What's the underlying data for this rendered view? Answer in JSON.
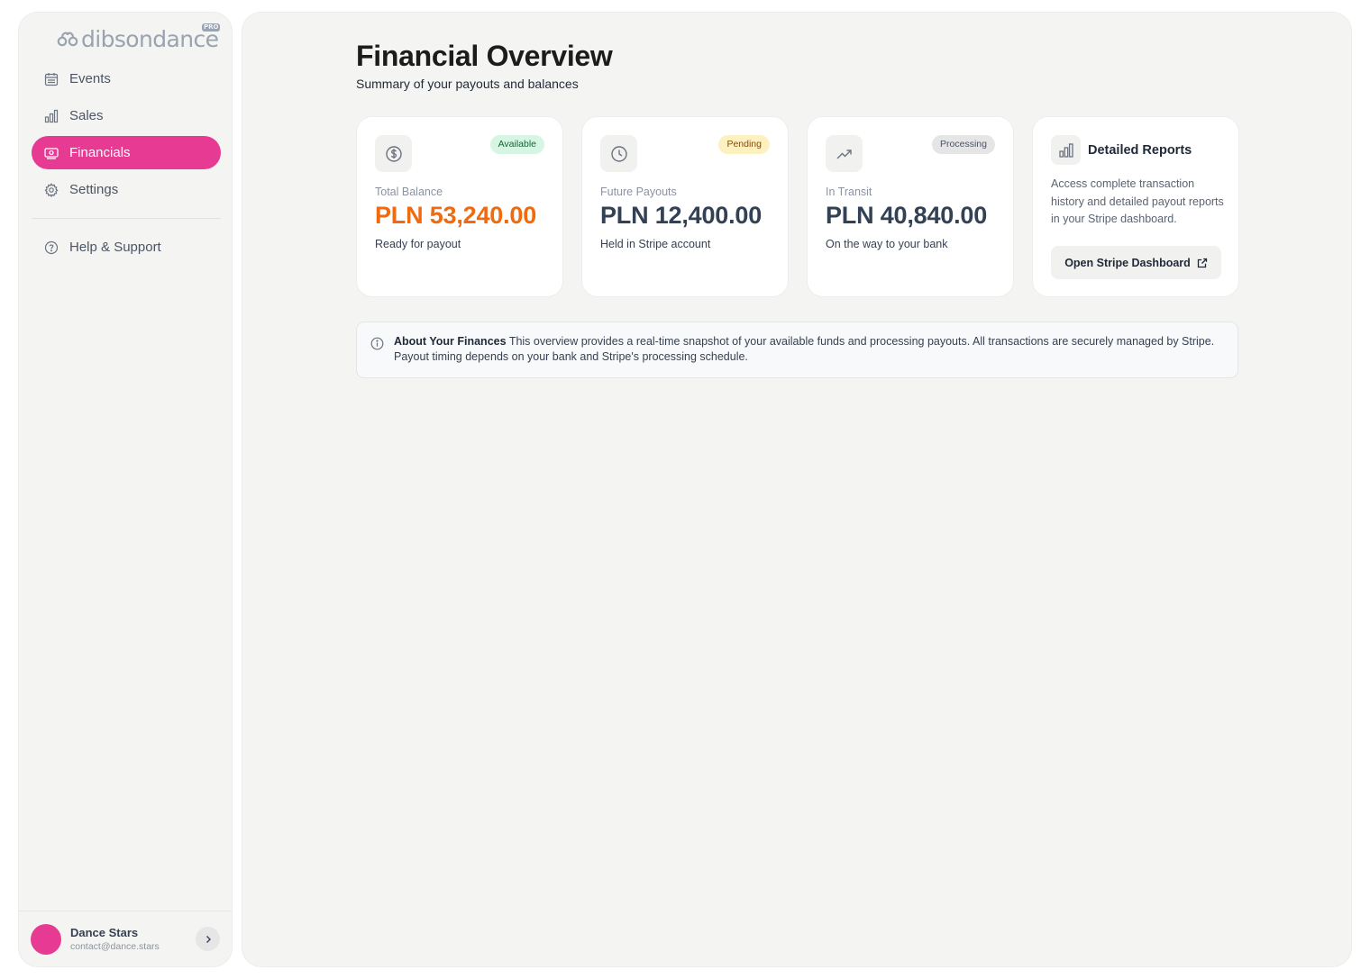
{
  "brand": {
    "logo_text": "dibsondance",
    "logo_badge": "PRO",
    "accent_color": "#e63a93"
  },
  "sidebar": {
    "items": [
      {
        "label": "Events",
        "icon": "calendar-icon",
        "active": false
      },
      {
        "label": "Sales",
        "icon": "bar-chart-icon",
        "active": false
      },
      {
        "label": "Financials",
        "icon": "money-icon",
        "active": true
      },
      {
        "label": "Settings",
        "icon": "gear-icon",
        "active": false
      }
    ],
    "help": {
      "label": "Help & Support",
      "icon": "help-circle-icon"
    }
  },
  "user": {
    "name": "Dance Stars",
    "email": "contact@dance.stars"
  },
  "page": {
    "title": "Financial Overview",
    "subtitle": "Summary of your payouts and balances"
  },
  "cards": [
    {
      "icon": "dollar-circle-icon",
      "badge": "Available",
      "badge_color": "#d6f5e3",
      "label": "Total Balance",
      "amount": "PLN 53,240.00",
      "amount_color": "#f06a0f",
      "desc": "Ready for payout"
    },
    {
      "icon": "clock-icon",
      "badge": "Pending",
      "badge_color": "#fdf1bf",
      "label": "Future Payouts",
      "amount": "PLN 12,400.00",
      "desc": "Held in Stripe account"
    },
    {
      "icon": "trending-up-icon",
      "badge": "Processing",
      "badge_color": "#e5e5e5",
      "label": "In Transit",
      "amount": "PLN 40,840.00",
      "desc": "On the way to your bank"
    }
  ],
  "reports": {
    "icon": "bar-chart-icon",
    "title": "Detailed Reports",
    "desc": "Access complete transaction history and detailed payout reports in your Stripe dashboard.",
    "button_label": "Open Stripe Dashboard"
  },
  "info": {
    "title": "About Your Finances",
    "text": "This overview provides a real-time snapshot of your available funds and processing payouts. All transactions are securely managed by Stripe. Payout timing depends on your bank and Stripe's processing schedule."
  }
}
